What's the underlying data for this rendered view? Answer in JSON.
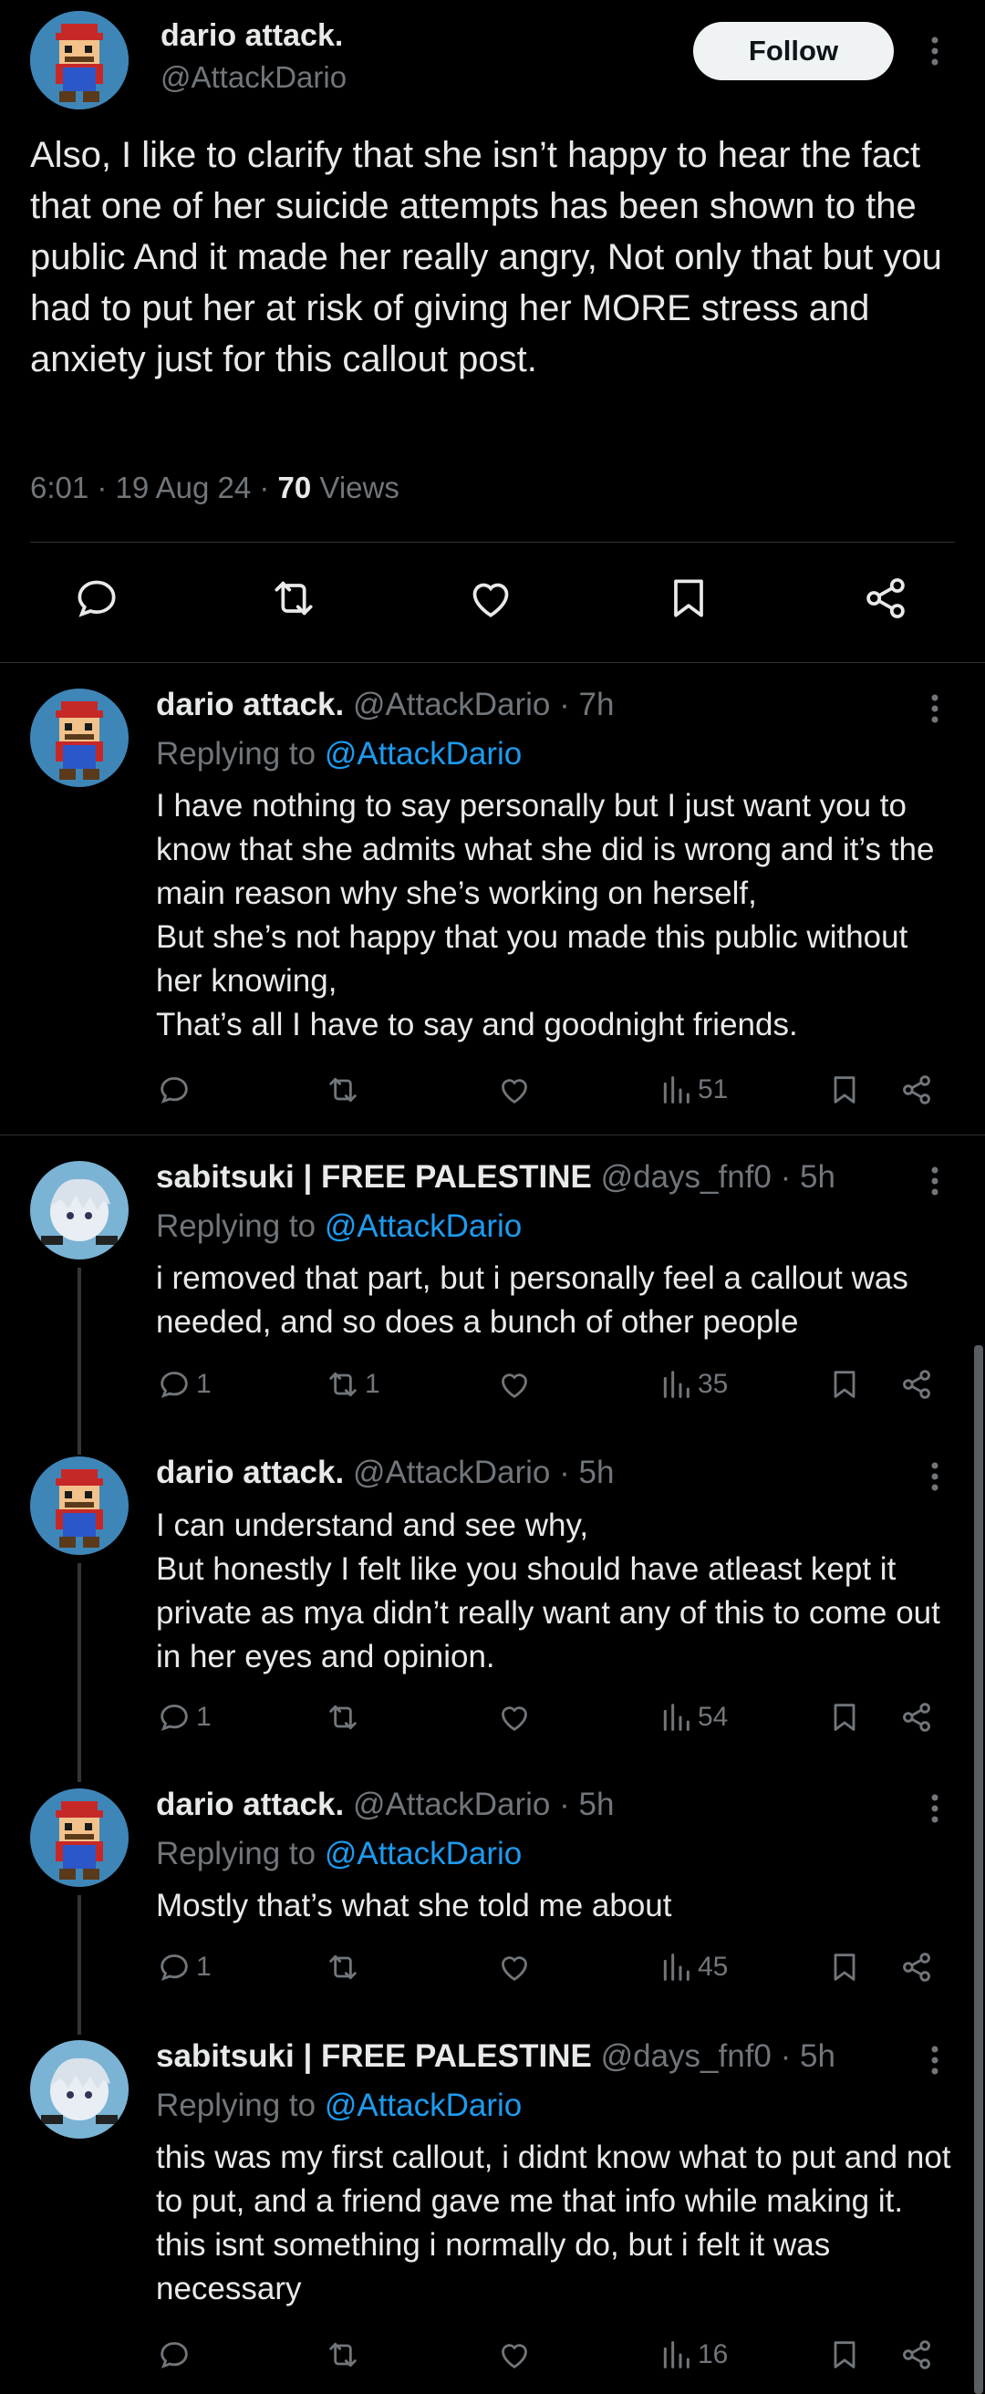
{
  "main_post": {
    "author_name": "dario attack.",
    "author_handle": "@AttackDario",
    "follow_label": "Follow",
    "text": "Also, I like to clarify that she isn’t happy to hear the fact that one of her suicide attempts has been shown to the public And it made her really angry, Not only that but you had to put her at risk of giving her MORE stress and anxiety just for this callout post.",
    "time": "6:01 · 19 Aug 24 · ",
    "views_count": "70",
    "views_label": " Views",
    "actions": [
      "reply-icon",
      "repost-icon",
      "like-icon",
      "bookmark-icon",
      "share-icon"
    ]
  },
  "replies": [
    {
      "name": "dario attack.",
      "handle": "@AttackDario",
      "time": "· 7h",
      "replying_prefix": "Replying to ",
      "replying_to": "@AttackDario",
      "text": "I have nothing to say personally but I just want you to know that she admits what she did is wrong and it’s the main reason why she’s working on herself,\nBut she’s not happy that you made this public without her knowing,\nThat’s all I have to say and goodnight friends.",
      "reply_count": "",
      "repost_count": "",
      "views": "51"
    },
    {
      "name": "sabitsuki | FREE PALESTINE",
      "handle": "@days_fnf0",
      "time": "· 5h",
      "replying_prefix": "Replying to ",
      "replying_to": "@AttackDario",
      "text": "i removed that part, but i personally feel a callout was needed, and so does a bunch of other people",
      "reply_count": "1",
      "repost_count": "1",
      "views": "35"
    },
    {
      "name": "dario attack.",
      "handle": "@AttackDario",
      "time": "· 5h",
      "replying_prefix": "",
      "replying_to": "",
      "text": "I can understand and see why,\nBut honestly I felt like you should have atleast kept it private as mya didn’t really want any of this to come out in her eyes and opinion.",
      "reply_count": "1",
      "repost_count": "",
      "views": "54"
    },
    {
      "name": "dario attack.",
      "handle": "@AttackDario",
      "time": "· 5h",
      "replying_prefix": "Replying to ",
      "replying_to": "@AttackDario",
      "text": "Mostly that’s what she told me about",
      "reply_count": "1",
      "repost_count": "",
      "views": "45"
    },
    {
      "name": "sabitsuki | FREE PALESTINE",
      "handle": "@days_fnf0",
      "time": "· 5h",
      "replying_prefix": "Replying to ",
      "replying_to": "@AttackDario",
      "text": "this was my first callout, i didnt know what to put and not to put, and a friend gave me that info while making it. this isnt something i normally do, but i felt it was necessary",
      "reply_count": "",
      "repost_count": "",
      "views": "16"
    }
  ],
  "colors": {
    "background": "#000000",
    "text": "#e7e9ea",
    "muted": "#71767b",
    "link": "#1d9bf0",
    "divider": "#2f3336"
  }
}
